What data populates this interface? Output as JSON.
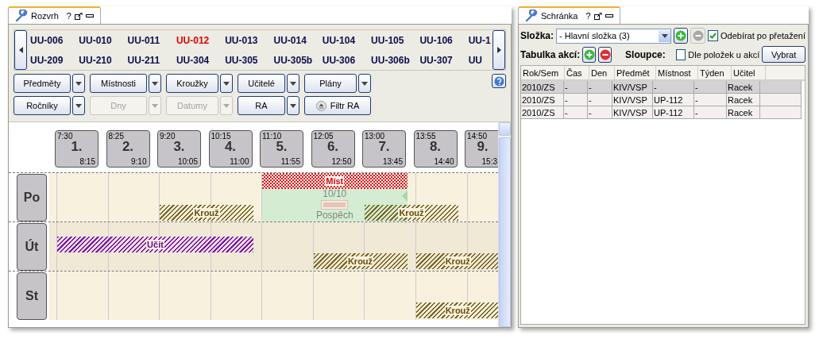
{
  "left_panel": {
    "tab": {
      "label": "Rozvrh",
      "help": "?"
    },
    "rooms": [
      [
        {
          "label": "UU-006",
          "selected": false
        },
        {
          "label": "UU-010",
          "selected": false
        },
        {
          "label": "UU-011",
          "selected": false
        },
        {
          "label": "UU-012",
          "selected": true
        },
        {
          "label": "UU-013",
          "selected": false
        },
        {
          "label": "UU-014",
          "selected": false
        },
        {
          "label": "UU-104",
          "selected": false
        },
        {
          "label": "UU-105",
          "selected": false
        },
        {
          "label": "UU-106",
          "selected": false
        },
        {
          "label": "UU-1",
          "selected": false
        }
      ],
      [
        {
          "label": "UU-209",
          "selected": false
        },
        {
          "label": "UU-210",
          "selected": false
        },
        {
          "label": "UU-211",
          "selected": false
        },
        {
          "label": "UU-304",
          "selected": false
        },
        {
          "label": "UU-305",
          "selected": false
        },
        {
          "label": "UU-305b",
          "selected": false
        },
        {
          "label": "UU-306",
          "selected": false
        },
        {
          "label": "UU-306b",
          "selected": false
        },
        {
          "label": "UU-307",
          "selected": false
        },
        {
          "label": "UU",
          "selected": false
        }
      ]
    ],
    "buttons": [
      [
        {
          "label": "Předměty",
          "kind": "split",
          "disabled": false
        },
        {
          "label": "Místnosti",
          "kind": "split",
          "disabled": false
        },
        {
          "label": "Kroužky",
          "kind": "split",
          "disabled": false
        },
        {
          "label": "Učitelé",
          "kind": "split",
          "disabled": false
        },
        {
          "label": "Plány",
          "kind": "split",
          "disabled": false
        }
      ],
      [
        {
          "label": "Ročníky",
          "kind": "split",
          "disabled": false
        },
        {
          "label": "Dny",
          "kind": "split",
          "disabled": true
        },
        {
          "label": "Datumy",
          "kind": "split",
          "disabled": true
        },
        {
          "label": "RA",
          "kind": "split",
          "disabled": false
        },
        {
          "label": "Filtr RA",
          "kind": "eject",
          "disabled": false
        }
      ]
    ],
    "periods": [
      {
        "start": "7:30",
        "number": "1.",
        "end": "8:15",
        "clipped": false
      },
      {
        "start": "8:25",
        "number": "2.",
        "end": "9:10",
        "clipped": false
      },
      {
        "start": "9:20",
        "number": "3.",
        "end": "10:05",
        "clipped": false
      },
      {
        "start": "10:15",
        "number": "4.",
        "end": "11:00",
        "clipped": false
      },
      {
        "start": "11:10",
        "number": "5.",
        "end": "11:55",
        "clipped": false
      },
      {
        "start": "12:05",
        "number": "6.",
        "end": "12:50",
        "clipped": false
      },
      {
        "start": "13:00",
        "number": "7.",
        "end": "13:45",
        "clipped": false
      },
      {
        "start": "13:55",
        "number": "8.",
        "end": "14:40",
        "clipped": false
      },
      {
        "start": "14:50",
        "number": "9.",
        "end": "15:3",
        "clipped": true
      }
    ],
    "days": [
      {
        "label": "Po",
        "events": [
          {
            "kind": "mistnost",
            "label": "Míst"
          },
          {
            "kind": "krouzek",
            "label": "Krouž"
          },
          {
            "kind": "pospech",
            "count": "10/10",
            "label": "Pospěch",
            "level": 1
          },
          {
            "kind": "krouzek",
            "label": "Krouž"
          }
        ]
      },
      {
        "label": "Út",
        "events": [
          {
            "kind": "ucitel",
            "label": "Učit"
          },
          {
            "kind": "krouzek",
            "label": "Krouž"
          },
          {
            "kind": "krouzek",
            "label": "Krouž"
          }
        ]
      },
      {
        "label": "St",
        "events": [
          {
            "kind": "krouzek",
            "label": "Krouž"
          }
        ]
      }
    ]
  },
  "right_panel": {
    "tab": {
      "label": "Schránka",
      "help": "?"
    },
    "folder": {
      "label": "Složka:",
      "value": "- Hlavní složka (3)",
      "remove_disabled": true,
      "remove_on_drop": {
        "label": "Odebírat po přetažení",
        "checked": true
      }
    },
    "actions": {
      "label": "Tabulka akcí:",
      "columns_label": "Sloupce:",
      "by_items": {
        "label": "Dle položek u akcí",
        "checked": false
      },
      "choose": "Vybrat"
    },
    "table": {
      "columns": [
        "Rok/Sem",
        "Čas",
        "Den",
        "Předmět",
        "Místnost",
        "Týden",
        "Učitel"
      ],
      "rows": [
        {
          "selected": true,
          "cells": [
            "2010/ZS",
            "-",
            "-",
            "KIV/VSP",
            "-",
            "-",
            "Racek"
          ]
        },
        {
          "selected": false,
          "cells": [
            "2010/ZS",
            "-",
            "-",
            "KIV/VSP",
            "UP-112",
            "-",
            "Racek"
          ]
        },
        {
          "selected": false,
          "cells": [
            "2010/ZS",
            "-",
            "-",
            "KIV/VSP",
            "UP-112",
            "-",
            "Racek"
          ]
        }
      ]
    }
  }
}
